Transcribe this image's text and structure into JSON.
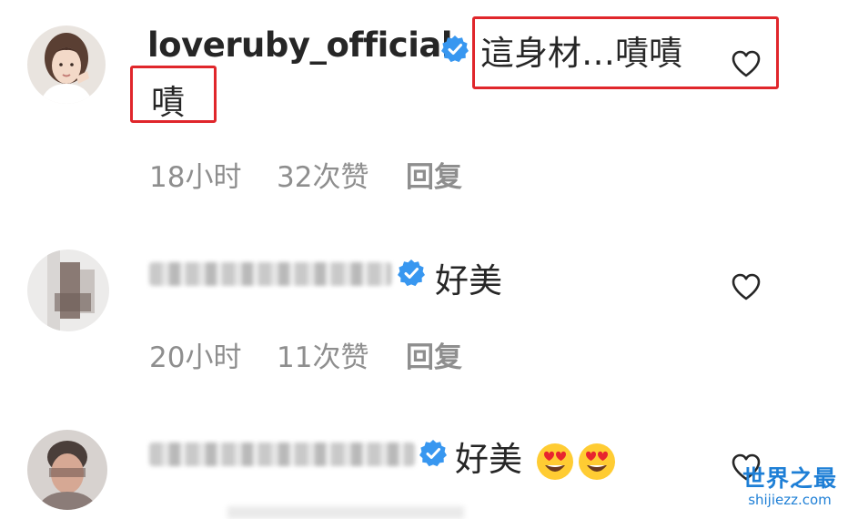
{
  "comments": [
    {
      "username": "loveruby_official",
      "verified": true,
      "text_line1": "這身材…嘖嘖",
      "text_line2": "嘖",
      "time": "18小时",
      "likes": "32次赞",
      "reply": "回复"
    },
    {
      "username": "",
      "verified": true,
      "text": "好美",
      "time": "20小时",
      "likes": "11次赞",
      "reply": "回复"
    },
    {
      "username": "",
      "verified": true,
      "text": "好美",
      "emojis": [
        "heart-eyes-emoji",
        "heart-eyes-emoji"
      ]
    }
  ],
  "watermark": {
    "title": "世界之最",
    "url": "shijiezz.com"
  },
  "colors": {
    "verified_blue": "#3897f0",
    "highlight_red": "#e0262b",
    "meta_gray": "#8e8e8e",
    "watermark_blue": "#1e7fd6"
  }
}
